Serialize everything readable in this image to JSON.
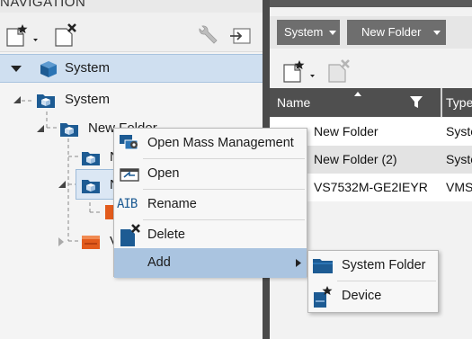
{
  "navigation": {
    "header": "NAVIGATION",
    "root": {
      "label": "System"
    },
    "tree": [
      {
        "label": "System"
      },
      {
        "label": "New Folder"
      },
      {
        "label": "N"
      },
      {
        "label": "N"
      },
      {
        "label": "V"
      }
    ]
  },
  "content": {
    "breadcrumb": [
      {
        "label": "System"
      },
      {
        "label": "New Folder"
      }
    ],
    "columns": {
      "name": "Name",
      "type": "Type"
    },
    "rows": [
      {
        "name": "New Folder",
        "type": "Syste"
      },
      {
        "name": "New Folder (2)",
        "type": "Syste"
      },
      {
        "name": "VS7532M-GE2IEYR",
        "type": "VMS"
      }
    ]
  },
  "context_menu": {
    "items": [
      {
        "label": "Open Mass Management"
      },
      {
        "label": "Open"
      },
      {
        "label": "Rename"
      },
      {
        "label": "Delete"
      },
      {
        "label": "Add"
      }
    ],
    "submenu": [
      {
        "label": "System Folder"
      },
      {
        "label": "Device"
      }
    ]
  },
  "colors": {
    "selection": "#cfdff0",
    "menu_hover": "#aac4e0",
    "folder_blue": "#1d5b93",
    "device_orange": "#e25b1c"
  }
}
